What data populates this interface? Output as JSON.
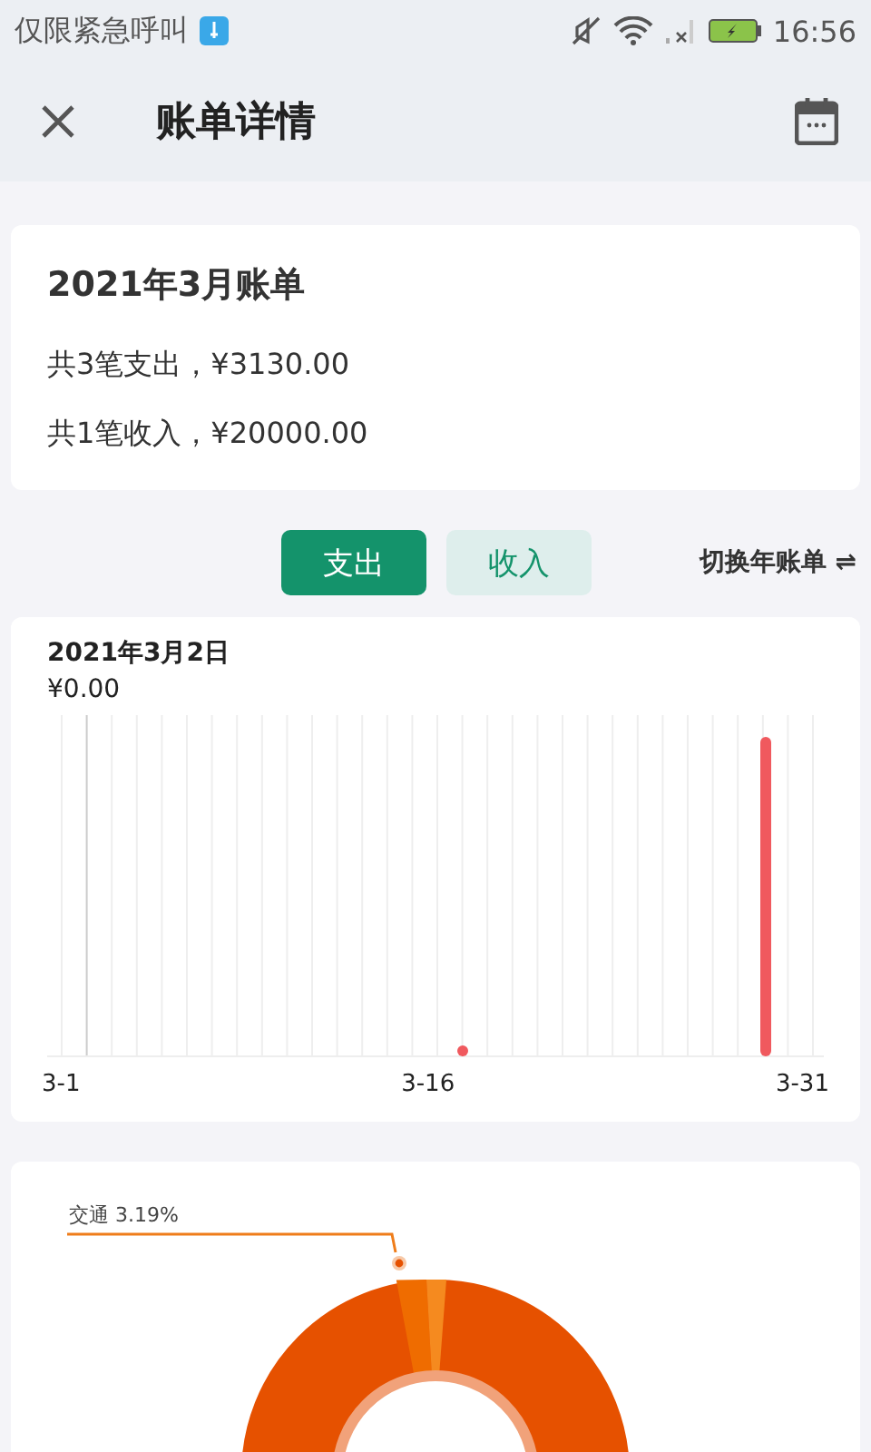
{
  "status_bar": {
    "carrier": "仅限紧急呼叫",
    "time": "16:56"
  },
  "header": {
    "title": "账单详情"
  },
  "summary": {
    "title": "2021年3月账单",
    "lines": [
      "共3笔支出，¥3130.00",
      "共1笔收入，¥20000.00"
    ]
  },
  "toggle": {
    "options": [
      {
        "label": "支出",
        "selected": true
      },
      {
        "label": "收入",
        "selected": false
      }
    ],
    "switch_label": "切换年账单 ⇌"
  },
  "daily_chart": {
    "date": "2021年3月2日",
    "amount": "¥0.00",
    "x_labels": [
      "3-1",
      "3-16",
      "3-31"
    ]
  },
  "category_chart": {
    "label": "交通 3.19%"
  }
}
